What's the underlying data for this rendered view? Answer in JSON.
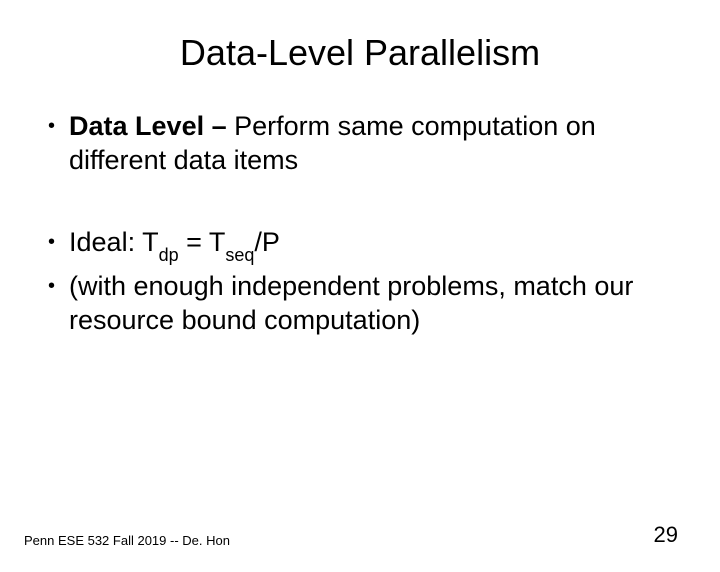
{
  "title": "Data-Level Parallelism",
  "bullets": {
    "b1_bold": "Data Level – ",
    "b1_rest": "Perform same computation on different data items",
    "b2_pre": "Ideal: T",
    "b2_sub1": "dp",
    "b2_mid": " = T",
    "b2_sub2": "seq",
    "b2_post": "/P",
    "b3": "(with enough independent problems, match our resource bound computation)"
  },
  "footer": "Penn ESE 532 Fall 2019 -- De. Hon",
  "page": "29"
}
